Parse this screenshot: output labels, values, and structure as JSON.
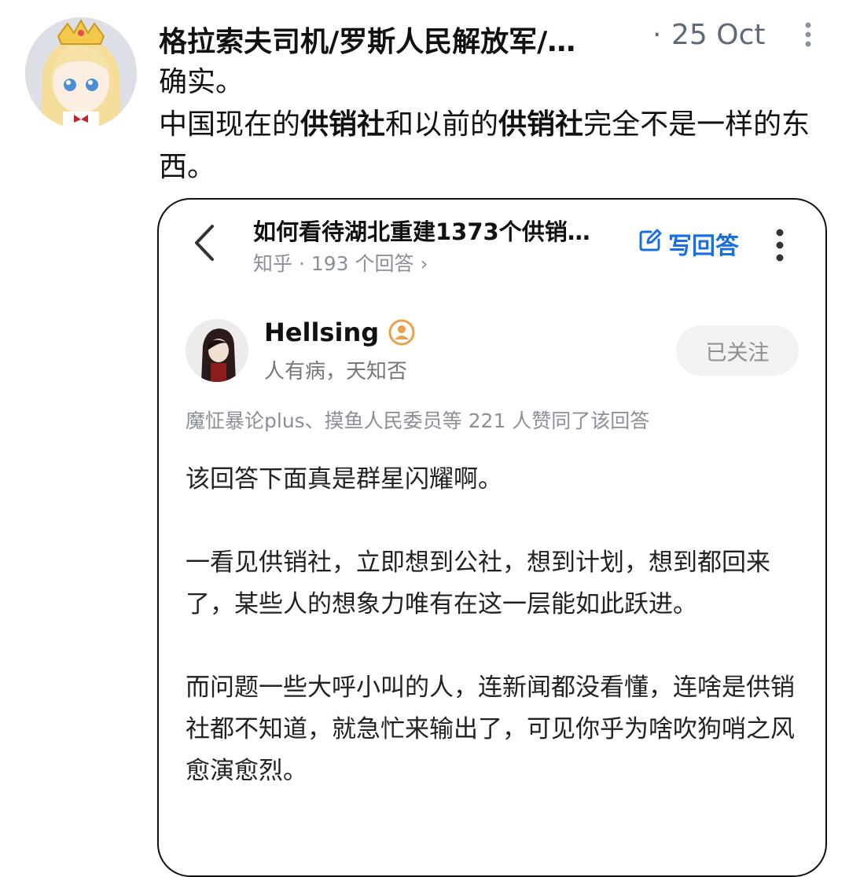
{
  "post": {
    "author_name": "格拉索夫司机/罗斯人民解放军/…",
    "separator": "·",
    "date": "25 Oct",
    "body": {
      "line1": "确实。",
      "line2_parts": [
        {
          "text": "中国现在的",
          "bold": false
        },
        {
          "text": "供销社",
          "bold": true
        },
        {
          "text": "和以前的",
          "bold": false
        },
        {
          "text": "供销社",
          "bold": true
        },
        {
          "text": "完全不是一样的东西。",
          "bold": false
        }
      ]
    }
  },
  "screenshot": {
    "question_title": "如何看待湖北重建1373个供销…",
    "meta": "知乎 · 193 个回答 ›",
    "write_answer_label": "写回答",
    "answerer": {
      "name": "Hellsing",
      "bio": "人有病，天知否",
      "follow_label": "已关注"
    },
    "likes_line": "魔怔暴论plus、摸鱼人民委员等 221 人赞同了该回答",
    "paragraphs": [
      "该回答下面真是群星闪耀啊。",
      "一看见供销社，立即想到公社，想到计划，想到都回来了，某些人的想象力唯有在这一层能如此跃进。",
      "而问题一些大呼小叫的人，连新闻都没看懂，连啥是供销社都不知道，就急忙来输出了，可见你乎为啥吹狗哨之风愈演愈烈。"
    ]
  },
  "icons": {
    "avatar": "anime-maid-avatar",
    "more": "more-vert-icon",
    "back": "chevron-left-icon",
    "edit": "edit-icon",
    "kebab": "kebab-icon",
    "badge": "user-badge-icon"
  },
  "colors": {
    "accent_blue": "#1a6fe0",
    "meta_gray": "#5f6b7a",
    "badge_orange": "#e8a24a"
  }
}
